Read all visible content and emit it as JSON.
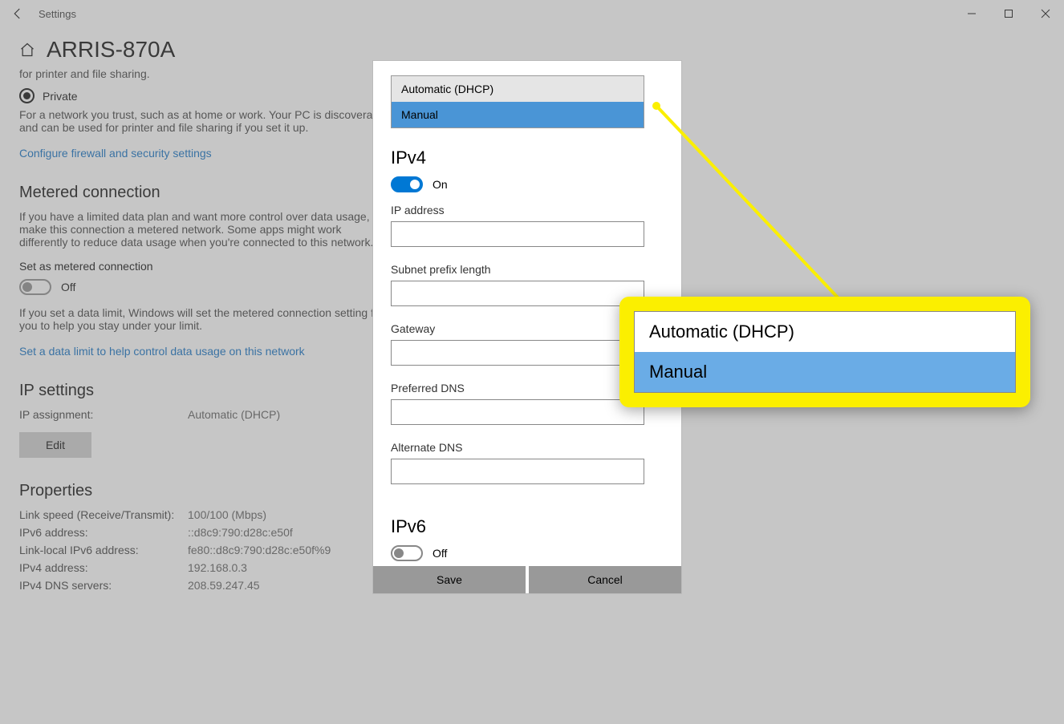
{
  "window": {
    "title": "Settings"
  },
  "page": {
    "title": "ARRIS-870A",
    "sharing_caption": "for printer and file sharing.",
    "radio_private": "Private",
    "private_desc": "For a network you trust, such as at home or work. Your PC is discoverable and can be used for printer and file sharing if you set it up.",
    "firewall_link": "Configure firewall and security settings",
    "metered_heading": "Metered connection",
    "metered_desc": "If you have a limited data plan and want more control over data usage, make this connection a metered network. Some apps might work differently to reduce data usage when you're connected to this network.",
    "metered_toggle_label": "Set as metered connection",
    "metered_toggle_state": "Off",
    "metered_limit_desc": "If you set a data limit, Windows will set the metered connection setting for you to help you stay under your limit.",
    "data_limit_link": "Set a data limit to help control data usage on this network",
    "ip_settings_heading": "IP settings",
    "ip_assignment_label": "IP assignment:",
    "ip_assignment_value": "Automatic (DHCP)",
    "edit_btn": "Edit",
    "properties_heading": "Properties",
    "props": [
      {
        "k": "Link speed (Receive/Transmit):",
        "v": "100/100 (Mbps)"
      },
      {
        "k": "IPv6 address:",
        "v": "::d8c9:790:d28c:e50f"
      },
      {
        "k": "Link-local IPv6 address:",
        "v": "fe80::d8c9:790:d28c:e50f%9"
      },
      {
        "k": "IPv4 address:",
        "v": "192.168.0.3"
      },
      {
        "k": "IPv4 DNS servers:",
        "v": "208.59.247.45"
      }
    ]
  },
  "dialog": {
    "dropdown": {
      "option_auto": "Automatic (DHCP)",
      "option_manual": "Manual"
    },
    "ipv4_heading": "IPv4",
    "ipv4_toggle_state": "On",
    "fields": {
      "ip_address": "IP address",
      "subnet": "Subnet prefix length",
      "gateway": "Gateway",
      "preferred_dns": "Preferred DNS",
      "alternate_dns": "Alternate DNS"
    },
    "ipv6_heading": "IPv6",
    "ipv6_toggle_state": "Off",
    "save_btn": "Save",
    "cancel_btn": "Cancel"
  },
  "callout": {
    "option_auto": "Automatic (DHCP)",
    "option_manual": "Manual"
  }
}
